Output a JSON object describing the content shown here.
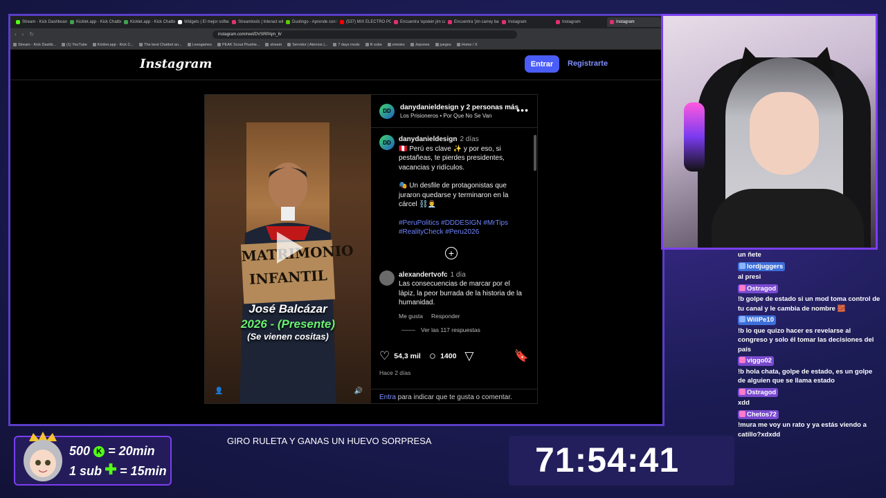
{
  "browser": {
    "tabs": [
      {
        "label": "Stream - Kick Dashboard",
        "color": "#53fc18"
      },
      {
        "label": "Kicklet.app - Kick Chatbot",
        "color": "#3fa34d"
      },
      {
        "label": "Kicklet.app - Kick Chatbot",
        "color": "#3fa34d"
      },
      {
        "label": "Widgets | El mejor software",
        "color": "#ffffff"
      },
      {
        "label": "Streamlools | Interact with",
        "color": "#e0336a"
      },
      {
        "label": "Duolingo - Aprende con la",
        "color": "#58cc02"
      },
      {
        "label": "(537) MIX ELECTRO POP",
        "color": "#ff0000"
      },
      {
        "label": "Encuentra 'epstein jim care",
        "color": "#e1306c"
      },
      {
        "label": "Encuentra 'jim carrey barb",
        "color": "#e1306c"
      },
      {
        "label": "Instagram",
        "color": "#e1306c"
      },
      {
        "label": "Instagram",
        "color": "#e1306c"
      },
      {
        "label": "Instagram",
        "color": "#e1306c"
      }
    ],
    "url": "instagram.com/reel/DVSRPAjm_6/",
    "bookmarks": [
      "Stream - Kick Dashb...",
      "(1) YouTube",
      "Kicklet.app - Kick C...",
      "The best Chatbot an...",
      "Lexogames",
      "PEAK Scout Plushie...",
      "stream",
      "Servidor | Aternos |...",
      "7 days mods",
      "R subs",
      "emotes",
      "Jepones",
      "juegos",
      "Home / X"
    ]
  },
  "instagram": {
    "logo": "Instagram",
    "login_label": "Entrar",
    "register_label": "Registrarte",
    "post": {
      "author": "danydanieldesign y 2 personas más",
      "song": "Los Prisioneros • Por Que No Se Van",
      "video": {
        "sign_text": "MATRIMONIO INFANTIL",
        "name": "José Balcázar",
        "years": "2026 - (Presente)",
        "sub": "(Se vienen cositas)"
      },
      "caption": {
        "user": "danydanieldesign",
        "time": "2 días",
        "text1": "🇵🇪 Perú es clave ✨ y por eso, si pestañeas, te pierdes presidentes, vacancias y ridículos.",
        "text2": "🎭 Un desfile de protagonistas que juraron quedarse y terminaron en la cárcel ⛓️👨‍💼",
        "tags": "#PeruPolitics #DDDESIGN #MrTips #RealityCheck #Peru2026"
      },
      "comment": {
        "user": "alexandertvofc",
        "time": "1 día",
        "text": "Las consecuencias de marcar por el lápiz, la peor burrada de la historia de la humanidad.",
        "like_label": "Me gusta",
        "reply_label": "Responder",
        "replies_label": "Ver las 117 respuestas"
      },
      "likes": "54,3 mil",
      "comments_count": "1400",
      "ago": "Hace 2 días",
      "login_link": "Entra",
      "login_rest": " para indicar que te gusta o comentar."
    }
  },
  "chat": [
    {
      "user": "",
      "text": "un ñete"
    },
    {
      "user": "lordjuggers",
      "style": "blue",
      "text": "al presi"
    },
    {
      "user": "Ostragod",
      "style": "purple",
      "text": "!b golpe de estado si un mod toma control de tu canal y le cambia de nombre 🧱"
    },
    {
      "user": "WillPe10",
      "style": "blue",
      "text": "!b lo que quizo hacer es revelarse al congreso y solo él tomar las decisiones del país"
    },
    {
      "user": "viggo02",
      "style": "purple",
      "text": "!b hola chata, golpe de estado, es un golpe de alguien que se llama estado"
    },
    {
      "user": "Ostragod",
      "style": "purple",
      "text": "xdd"
    },
    {
      "user": "Chetos72",
      "style": "purple",
      "text": "!mura me voy un rato y ya estás viendo a catillo?xdxdd"
    }
  ],
  "overlay": {
    "promo_line1": "500",
    "promo_line1_rest": "= 20min",
    "promo_line2": "1 sub",
    "promo_line2_rest": "= 15min",
    "ruleta": "GIRO RULETA Y GANAS UN HUEVO SORPRESA",
    "timer": "71:54:41"
  }
}
